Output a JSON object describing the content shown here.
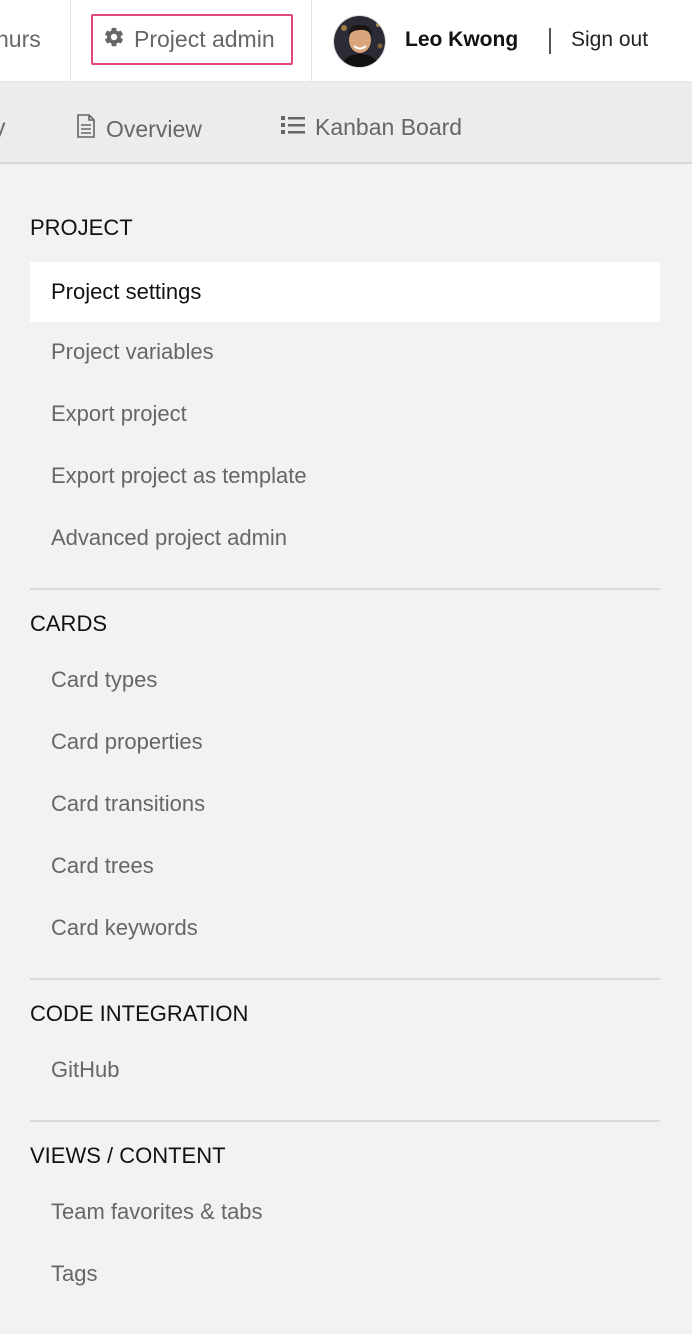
{
  "header": {
    "left_cut_text": "hurs",
    "project_admin_label": "Project admin",
    "user_name": "Leo Kwong",
    "sign_out_label": "Sign out"
  },
  "tabs": {
    "left_cut": "y",
    "items": [
      {
        "label": "Overview",
        "icon": "document-icon"
      },
      {
        "label": "Kanban Board",
        "icon": "list-icon"
      }
    ]
  },
  "menu": {
    "sections": [
      {
        "title": "PROJECT",
        "items": [
          "Project settings",
          "Project variables",
          "Export project",
          "Export project as template",
          "Advanced project admin"
        ]
      },
      {
        "title": "CARDS",
        "items": [
          "Card types",
          "Card properties",
          "Card transitions",
          "Card trees",
          "Card keywords"
        ]
      },
      {
        "title": "CODE INTEGRATION",
        "items": [
          "GitHub"
        ]
      },
      {
        "title": "VIEWS / CONTENT",
        "items": [
          "Team favorites & tabs",
          "Tags"
        ]
      }
    ],
    "active_item": "Project settings"
  },
  "colors": {
    "accent_border": "#e0457b",
    "background": "#f2f2f2",
    "active_bg": "#ffffff"
  }
}
